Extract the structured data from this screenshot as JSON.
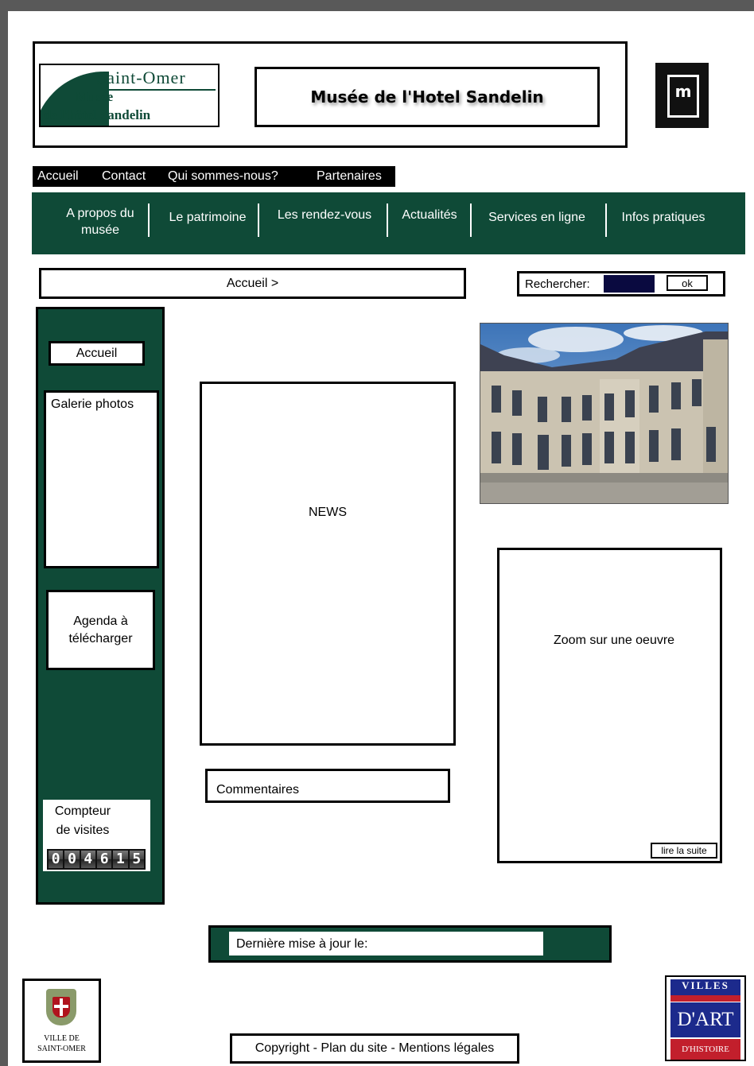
{
  "header": {
    "logo": {
      "line1": "Saint-Omer",
      "line2": "Musée",
      "line3": "de l'hôtel Sandelin"
    },
    "site_title": "Musée de l'Hotel Sandelin",
    "m_logo": {
      "mark": "m"
    }
  },
  "top_nav": [
    "Accueil",
    "Contact",
    "Qui sommes-nous?",
    "Partenaires"
  ],
  "main_nav": [
    {
      "line1": "A propos du",
      "line2": "musée"
    },
    {
      "line1": "Le patrimoine",
      "line2": ""
    },
    {
      "line1": "Les rendez-vous",
      "line2": ""
    },
    {
      "line1": "Actualités",
      "line2": ""
    },
    {
      "line1": "Services en ligne",
      "line2": ""
    },
    {
      "line1": "Infos pratiques",
      "line2": ""
    }
  ],
  "breadcrumb": "Accueil >",
  "search": {
    "label": "Rechercher:",
    "value": "",
    "button": "ok"
  },
  "sidebar": {
    "home": "Accueil",
    "gallery": "Galerie photos",
    "agenda": {
      "line1": "Agenda à",
      "line2": "télécharger"
    },
    "counter": {
      "line1": "Compteur",
      "line2": "de visites",
      "value": "004615"
    }
  },
  "news": {
    "label": "NEWS"
  },
  "comments": {
    "label": "Commentaires"
  },
  "zoom": {
    "label": "Zoom sur une oeuvre",
    "read_more": "lire la suite"
  },
  "update": {
    "label": "Dernière mise à jour le:"
  },
  "footer": {
    "ville_logo": {
      "line1": "VILLE DE",
      "line2": "SAINT-OMER"
    },
    "copyright": "Copyright  - Plan du site -  Mentions légales",
    "villes_logo": {
      "top": "VILLES",
      "mid": "D'ART",
      "bottom": "D'HISTOIRE"
    }
  },
  "colors": {
    "brand_green": "#0f4a37",
    "frame_gray": "#595959",
    "search_fill": "#0a0a40"
  }
}
